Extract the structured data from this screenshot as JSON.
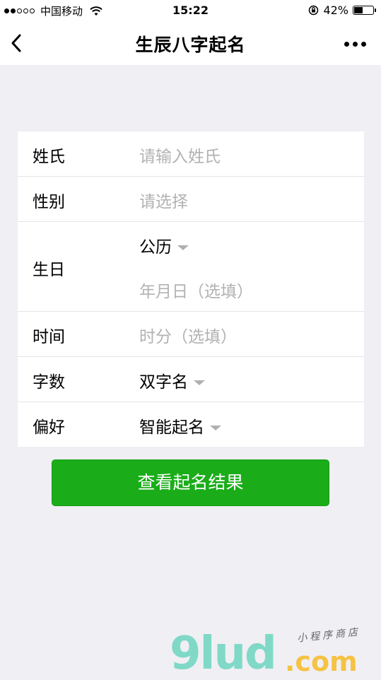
{
  "status_bar": {
    "carrier": "中国移动",
    "time": "15:22",
    "battery": "42%",
    "battery_level": 0.42
  },
  "nav": {
    "title": "生辰八字起名"
  },
  "form": {
    "surname": {
      "label": "姓氏",
      "placeholder": "请输入姓氏"
    },
    "gender": {
      "label": "性别",
      "placeholder": "请选择"
    },
    "birthday": {
      "label": "生日",
      "calendar": "公历",
      "date_placeholder": "年月日（选填）"
    },
    "time": {
      "label": "时间",
      "placeholder": "时分（选填）"
    },
    "count": {
      "label": "字数",
      "value": "双字名"
    },
    "preference": {
      "label": "偏好",
      "value": "智能起名"
    }
  },
  "submit_label": "查看起名结果",
  "watermark": {
    "brand": "9lud",
    "domain": ".com",
    "tagline": "小程序商店"
  }
}
